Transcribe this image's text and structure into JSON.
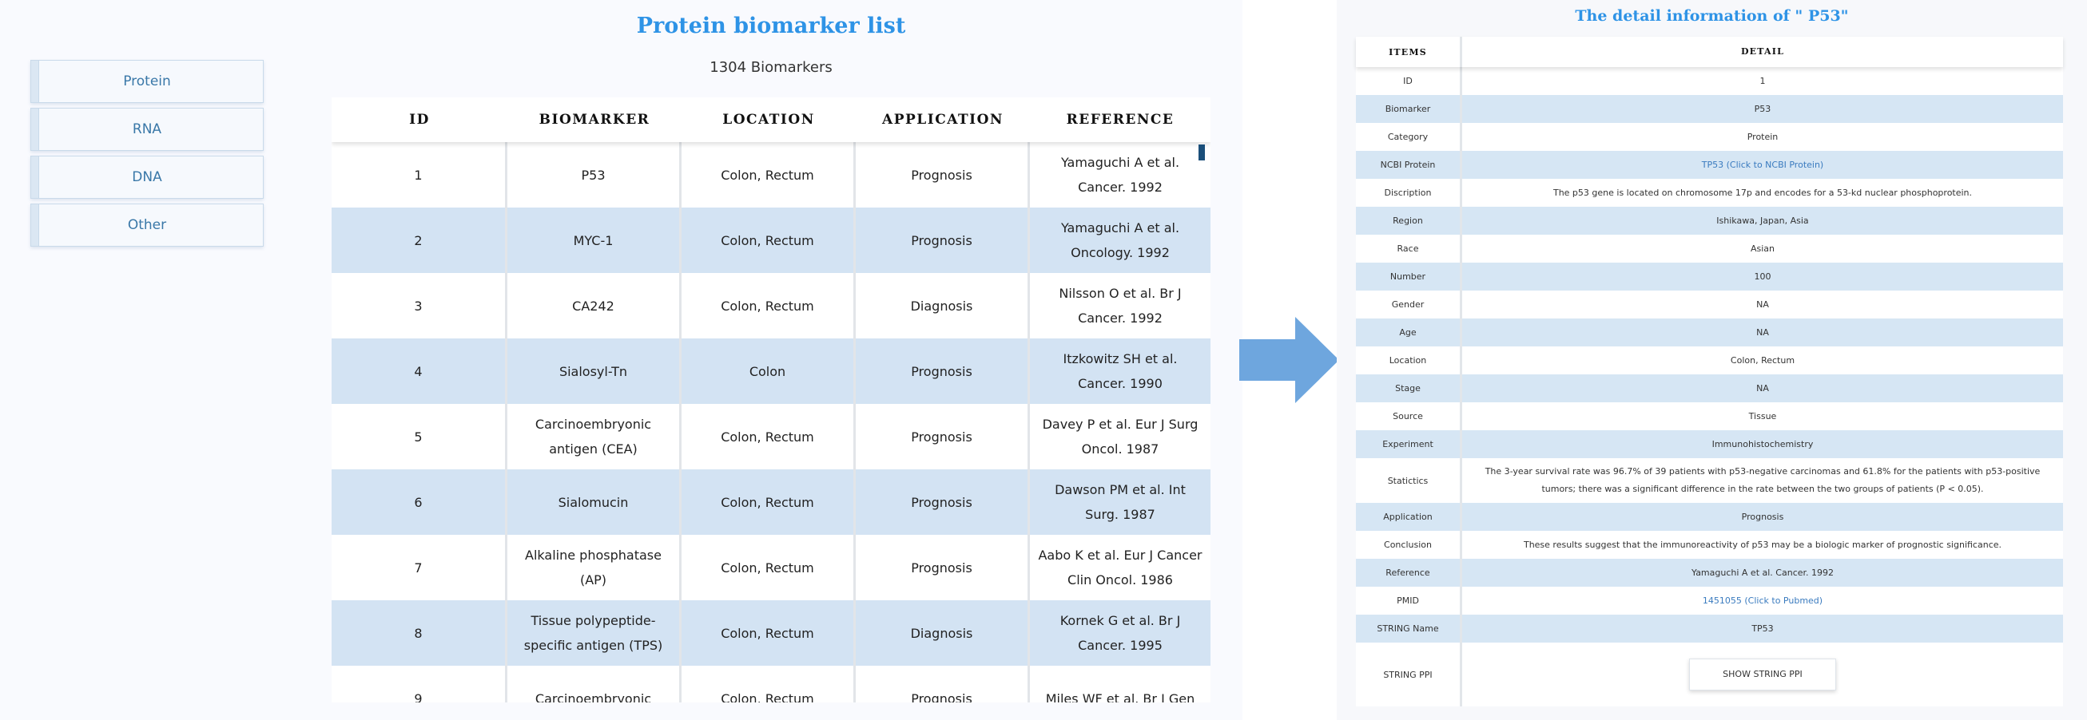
{
  "sidebar": {
    "items": [
      {
        "label": "Protein"
      },
      {
        "label": "RNA"
      },
      {
        "label": "DNA"
      },
      {
        "label": "Other"
      }
    ]
  },
  "list": {
    "title": "Protein biomarker list",
    "count": "1304 Biomarkers",
    "headers": {
      "id": "ID",
      "biomarker": "BIOMARKER",
      "location": "LOCATION",
      "application": "APPLICATION",
      "reference": "REFERENCE"
    },
    "rows": [
      {
        "id": "1",
        "biomarker": "P53",
        "location": "Colon, Rectum",
        "application": "Prognosis",
        "reference": "Yamaguchi A et al. Cancer. 1992"
      },
      {
        "id": "2",
        "biomarker": "MYC-1",
        "location": "Colon, Rectum",
        "application": "Prognosis",
        "reference": "Yamaguchi A et al. Oncology. 1992"
      },
      {
        "id": "3",
        "biomarker": "CA242",
        "location": "Colon, Rectum",
        "application": "Diagnosis",
        "reference": "Nilsson O et al. Br J Cancer. 1992"
      },
      {
        "id": "4",
        "biomarker": "Sialosyl-Tn",
        "location": "Colon",
        "application": "Prognosis",
        "reference": "Itzkowitz SH et al. Cancer. 1990"
      },
      {
        "id": "5",
        "biomarker": "Carcinoembryonic antigen (CEA)",
        "location": "Colon, Rectum",
        "application": "Prognosis",
        "reference": "Davey P et al. Eur J Surg Oncol. 1987"
      },
      {
        "id": "6",
        "biomarker": "Sialomucin",
        "location": "Colon, Rectum",
        "application": "Prognosis",
        "reference": "Dawson PM et al. Int Surg. 1987"
      },
      {
        "id": "7",
        "biomarker": "Alkaline phosphatase (AP)",
        "location": "Colon, Rectum",
        "application": "Prognosis",
        "reference": "Aabo K et al. Eur J Cancer Clin Oncol. 1986"
      },
      {
        "id": "8",
        "biomarker": "Tissue polypeptide-specific antigen (TPS)",
        "location": "Colon, Rectum",
        "application": "Diagnosis",
        "reference": "Kornek G et al. Br J Cancer. 1995"
      },
      {
        "id": "9",
        "biomarker": "Carcinoembryonic",
        "location": "Colon, Rectum",
        "application": "Prognosis",
        "reference": "Miles WF et al. Br J Gen"
      }
    ]
  },
  "detail": {
    "title": "The detail information of \" P53\"",
    "headers": {
      "items": "ITEMS",
      "detail": "DETAIL"
    },
    "rows": [
      {
        "label": "ID",
        "value": "1"
      },
      {
        "label": "Biomarker",
        "value": "P53"
      },
      {
        "label": "Category",
        "value": "Protein"
      },
      {
        "label": "NCBI Protein",
        "value": "TP53 (Click to NCBI Protein)"
      },
      {
        "label": "Discription",
        "value": "The p53 gene is located on chromosome 17p and encodes for a 53-kd nuclear phosphoprotein."
      },
      {
        "label": "Region",
        "value": "Ishikawa, Japan, Asia"
      },
      {
        "label": "Race",
        "value": "Asian"
      },
      {
        "label": "Number",
        "value": "100"
      },
      {
        "label": "Gender",
        "value": "NA"
      },
      {
        "label": "Age",
        "value": "NA"
      },
      {
        "label": "Location",
        "value": "Colon, Rectum"
      },
      {
        "label": "Stage",
        "value": "NA"
      },
      {
        "label": "Source",
        "value": "Tissue"
      },
      {
        "label": "Experiment",
        "value": "Immunohistochemistry"
      },
      {
        "label": "Statictics",
        "value": "The 3-year survival rate was 96.7% of 39 patients with p53-negative carcinomas and 61.8% for the patients with p53-positive tumors; there was a significant difference in the rate between the two groups of patients (P < 0.05)."
      },
      {
        "label": "Application",
        "value": "Prognosis"
      },
      {
        "label": "Conclusion",
        "value": "These results suggest that the immunoreactivity of p53 may be a biologic marker of prognostic significance."
      },
      {
        "label": "Reference",
        "value": "Yamaguchi A et al. Cancer. 1992"
      },
      {
        "label": "PMID",
        "value": "1451055 (Click to Pubmed)"
      },
      {
        "label": "STRING Name",
        "value": "TP53"
      },
      {
        "label": "STRING PPI",
        "button": "SHOW STRING PPI"
      }
    ]
  },
  "colors": {
    "title_blue": "#2e93e6",
    "row_alt": "#d3e3f3",
    "arrow": "#6ea6de",
    "link": "#3a7bbf"
  },
  "icons": {
    "arrow": "right-arrow-icon"
  }
}
